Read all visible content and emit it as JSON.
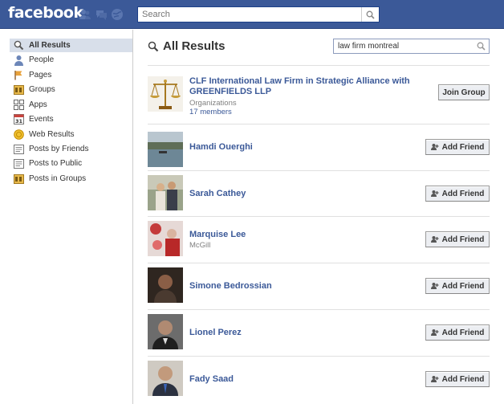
{
  "header": {
    "logo": "facebook",
    "search_placeholder": "Search",
    "icons": [
      "friend-requests-icon",
      "messages-icon",
      "notifications-icon"
    ]
  },
  "sidebar": {
    "items": [
      {
        "label": "All Results",
        "icon": "search-icon",
        "selected": true
      },
      {
        "label": "People",
        "icon": "person-icon"
      },
      {
        "label": "Pages",
        "icon": "pages-flag-icon"
      },
      {
        "label": "Groups",
        "icon": "groups-icon"
      },
      {
        "label": "Apps",
        "icon": "apps-icon"
      },
      {
        "label": "Events",
        "icon": "calendar-icon"
      },
      {
        "label": "Web Results",
        "icon": "web-results-icon"
      },
      {
        "label": "Posts by Friends",
        "icon": "posts-icon"
      },
      {
        "label": "Posts to Public",
        "icon": "posts-icon"
      },
      {
        "label": "Posts in Groups",
        "icon": "groups-icon"
      }
    ]
  },
  "main": {
    "title": "All Results",
    "query": "law firm montreal",
    "results": [
      {
        "name": "CLF International Law Firm in Strategic Alliance with GREENFIELDS LLP",
        "subtitle": "Organizations",
        "link": "17 members",
        "action": "Join Group"
      },
      {
        "name": "Hamdi Ouerghi",
        "subtitle": "",
        "action": "Add Friend"
      },
      {
        "name": "Sarah Cathey",
        "subtitle": "",
        "action": "Add Friend"
      },
      {
        "name": "Marquise Lee",
        "subtitle": "McGill",
        "action": "Add Friend"
      },
      {
        "name": "Simone Bedrossian",
        "subtitle": "",
        "action": "Add Friend"
      },
      {
        "name": "Lionel Perez",
        "subtitle": "",
        "action": "Add Friend"
      },
      {
        "name": "Fady Saad",
        "subtitle": "",
        "action": "Add Friend"
      }
    ]
  },
  "colors": {
    "brand": "#3b5998",
    "selected": "#d8dfea",
    "link": "#3b5998"
  }
}
